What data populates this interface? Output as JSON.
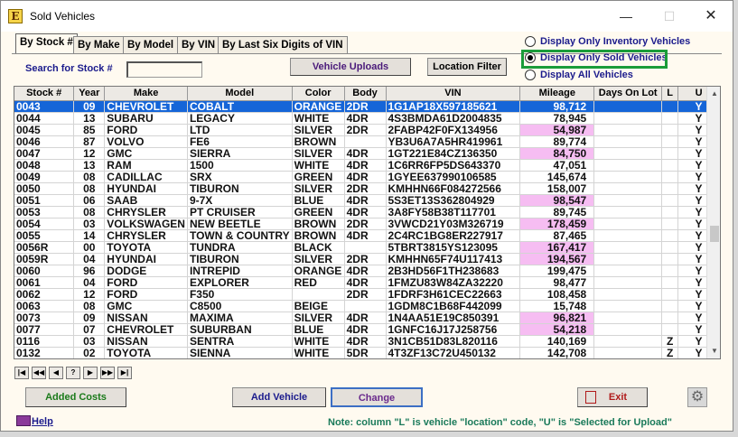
{
  "window": {
    "title": "Sold Vehicles",
    "app_icon": "E",
    "minimize": "—",
    "maximize": "☐",
    "close": "✕"
  },
  "tabs": [
    {
      "label": "By Stock #",
      "active": true
    },
    {
      "label": "By Make",
      "active": false
    },
    {
      "label": "By Model",
      "active": false
    },
    {
      "label": "By VIN",
      "active": false
    },
    {
      "label": "By Last Six Digits of VIN",
      "active": false
    }
  ],
  "filters": {
    "inventory": "Display Only Inventory Vehicles",
    "sold": "Display Only Sold Vehicles",
    "all": "Display All Vehicles",
    "selected": "sold",
    "highlight_color": "#1a9c3a"
  },
  "search": {
    "label": "Search for Stock #",
    "value": ""
  },
  "toolbar": {
    "uploads": "Vehicle Uploads",
    "location_filter": "Location Filter"
  },
  "table": {
    "headers": [
      "Stock #",
      "Year",
      "Make",
      "Model",
      "Color",
      "Body",
      "VIN",
      "Mileage",
      "Days On Lot",
      "L",
      "U"
    ],
    "rows": [
      {
        "cells": [
          "0043",
          "09",
          "CHEVROLET",
          "COBALT",
          "ORANGE",
          "2DR",
          "1G1AP18X597185621",
          "98,712",
          "",
          "",
          "Y"
        ],
        "selected": true,
        "pink": false
      },
      {
        "cells": [
          "0044",
          "13",
          "SUBARU",
          "LEGACY",
          "WHITE",
          "4DR",
          "4S3BMDA61D2004835",
          "78,945",
          "",
          "",
          "Y"
        ],
        "selected": false,
        "pink": false
      },
      {
        "cells": [
          "0045",
          "85",
          "FORD",
          "LTD",
          "SILVER",
          "2DR",
          "2FABP42F0FX134956",
          "54,987",
          "",
          "",
          "Y"
        ],
        "selected": false,
        "pink": true
      },
      {
        "cells": [
          "0046",
          "87",
          "VOLVO",
          "FE6",
          "BROWN",
          "",
          "YB3U6A7A5HR419961",
          "89,774",
          "",
          "",
          "Y"
        ],
        "selected": false,
        "pink": false
      },
      {
        "cells": [
          "0047",
          "12",
          "GMC",
          "SIERRA",
          "SILVER",
          "4DR",
          "1GT221E84CZ136350",
          "84,750",
          "",
          "",
          "Y"
        ],
        "selected": false,
        "pink": true
      },
      {
        "cells": [
          "0048",
          "13",
          "RAM",
          "1500",
          "WHITE",
          "4DR",
          "1C6RR6FP5DS643370",
          "47,051",
          "",
          "",
          "Y"
        ],
        "selected": false,
        "pink": false
      },
      {
        "cells": [
          "0049",
          "08",
          "CADILLAC",
          "SRX",
          "GREEN",
          "4DR",
          "1GYEE637990106585",
          "145,674",
          "",
          "",
          "Y"
        ],
        "selected": false,
        "pink": false
      },
      {
        "cells": [
          "0050",
          "08",
          "HYUNDAI",
          "TIBURON",
          "SILVER",
          "2DR",
          "KMHHN66F084272566",
          "158,007",
          "",
          "",
          "Y"
        ],
        "selected": false,
        "pink": false
      },
      {
        "cells": [
          "0051",
          "06",
          "SAAB",
          "9-7X",
          "BLUE",
          "4DR",
          "5S3ET13S362804929",
          "98,547",
          "",
          "",
          "Y"
        ],
        "selected": false,
        "pink": true
      },
      {
        "cells": [
          "0053",
          "08",
          "CHRYSLER",
          "PT CRUISER",
          "GREEN",
          "4DR",
          "3A8FY58B38T117701",
          "89,745",
          "",
          "",
          "Y"
        ],
        "selected": false,
        "pink": false
      },
      {
        "cells": [
          "0054",
          "03",
          "VOLKSWAGEN",
          "NEW BEETLE",
          "BROWN",
          "2DR",
          "3VWCD21Y03M326719",
          "178,459",
          "",
          "",
          "Y"
        ],
        "selected": false,
        "pink": true
      },
      {
        "cells": [
          "0055",
          "14",
          "CHRYSLER",
          "TOWN & COUNTRY",
          "BROWN",
          "4DR",
          "2C4RC1BG8ER227917",
          "87,465",
          "",
          "",
          "Y"
        ],
        "selected": false,
        "pink": false
      },
      {
        "cells": [
          "0056R",
          "00",
          "TOYOTA",
          "TUNDRA",
          "BLACK",
          "",
          "5TBRT3815YS123095",
          "167,417",
          "",
          "",
          "Y"
        ],
        "selected": false,
        "pink": true
      },
      {
        "cells": [
          "0059R",
          "04",
          "HYUNDAI",
          "TIBURON",
          "SILVER",
          "2DR",
          "KMHHN65F74U117413",
          "194,567",
          "",
          "",
          "Y"
        ],
        "selected": false,
        "pink": true
      },
      {
        "cells": [
          "0060",
          "96",
          "DODGE",
          "INTREPID",
          "ORANGE",
          "4DR",
          "2B3HD56F1TH238683",
          "199,475",
          "",
          "",
          "Y"
        ],
        "selected": false,
        "pink": false
      },
      {
        "cells": [
          "0061",
          "04",
          "FORD",
          "EXPLORER",
          "RED",
          "4DR",
          "1FMZU83W84ZA32220",
          "98,477",
          "",
          "",
          "Y"
        ],
        "selected": false,
        "pink": false
      },
      {
        "cells": [
          "0062",
          "12",
          "FORD",
          "F350",
          "",
          "2DR",
          "1FDRF3H61CEC22663",
          "108,458",
          "",
          "",
          "Y"
        ],
        "selected": false,
        "pink": false
      },
      {
        "cells": [
          "0063",
          "08",
          "GMC",
          "C8500",
          "BEIGE",
          "",
          "1GDM8C1B68F442099",
          "15,748",
          "",
          "",
          "Y"
        ],
        "selected": false,
        "pink": false
      },
      {
        "cells": [
          "0073",
          "09",
          "NISSAN",
          "MAXIMA",
          "SILVER",
          "4DR",
          "1N4AA51E19C850391",
          "96,821",
          "",
          "",
          "Y"
        ],
        "selected": false,
        "pink": true
      },
      {
        "cells": [
          "0077",
          "07",
          "CHEVROLET",
          "SUBURBAN",
          "BLUE",
          "4DR",
          "1GNFC16J17J258756",
          "54,218",
          "",
          "",
          "Y"
        ],
        "selected": false,
        "pink": true
      },
      {
        "cells": [
          "0116",
          "03",
          "NISSAN",
          "SENTRA",
          "WHITE",
          "4DR",
          "3N1CB51D83L820116",
          "140,169",
          "",
          "Z",
          "Y"
        ],
        "selected": false,
        "pink": false
      },
      {
        "cells": [
          "0132",
          "02",
          "TOYOTA",
          "SIENNA",
          "WHITE",
          "5DR",
          "4T3ZF13C72U450132",
          "142,708",
          "",
          "Z",
          "Y"
        ],
        "selected": false,
        "pink": false
      }
    ]
  },
  "navigator": [
    "|◀",
    "◀◀",
    "◀",
    "?",
    "▶",
    "▶▶",
    "▶|"
  ],
  "buttons": {
    "added_costs": "Added Costs",
    "add_vehicle": "Add Vehicle",
    "change": "Change",
    "exit": "Exit",
    "settings": "⚙"
  },
  "help": "Help",
  "note": "Note: column \"L\" is vehicle \"location\" code, \"U\" is \"Selected for Upload\""
}
